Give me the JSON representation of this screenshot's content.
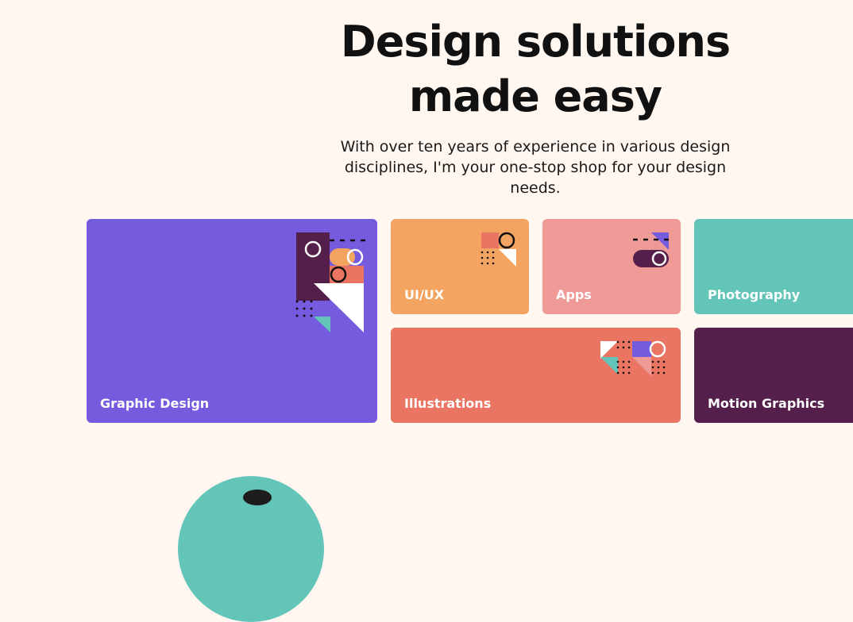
{
  "hero": {
    "title_line1": "Design solutions",
    "title_line2": "made easy",
    "subtitle": "With over ten years of experience in various design disciplines, I'm your one-stop shop for your design needs."
  },
  "cards": {
    "graphic_design": {
      "label": "Graphic Design",
      "color": "#755BDE"
    },
    "uiux": {
      "label": "UI/UX",
      "color": "#F4A461"
    },
    "apps": {
      "label": "Apps",
      "color": "#F09A98"
    },
    "photography": {
      "label": "Photography",
      "color": "#62C5B8"
    },
    "illustrations": {
      "label": "Illustrations",
      "color": "#EA7562"
    },
    "motion_graphics": {
      "label": "Motion Graphics",
      "color": "#541F4A"
    }
  },
  "icons": {
    "graphic_design": "geometric-shapes-icon",
    "uiux": "geometric-shapes-icon",
    "apps": "toggle-switch-icon",
    "illustrations": "geometric-shapes-icon"
  },
  "avatar": {
    "icon": "avatar-icon"
  }
}
